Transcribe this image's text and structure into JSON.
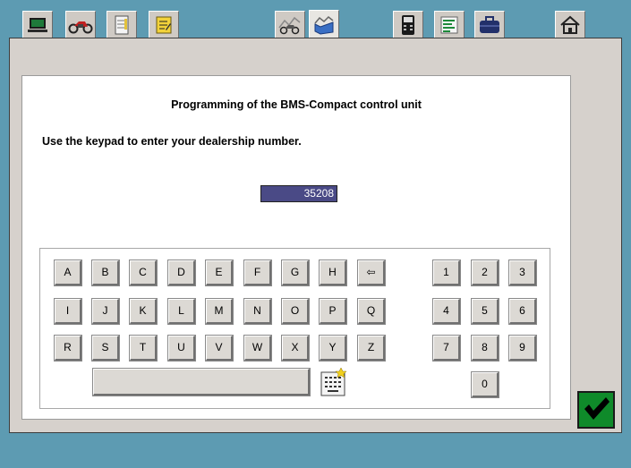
{
  "toolbar": {
    "tabs": [
      {
        "icon": "laptop-icon"
      },
      {
        "icon": "motorcycle-icon"
      },
      {
        "icon": "notepad-icon"
      },
      {
        "icon": "notes-edit-icon"
      },
      {
        "icon": "motorcycle-chart-icon"
      },
      {
        "icon": "chart-box-icon"
      },
      {
        "icon": "control-unit-icon"
      },
      {
        "icon": "list-icon"
      },
      {
        "icon": "toolcase-icon"
      },
      {
        "icon": "house-icon"
      }
    ]
  },
  "dialog": {
    "title": "Programming of the BMS-Compact control unit",
    "instruction": "Use the keypad to enter your dealership number.",
    "entry_value": "35208"
  },
  "keypad": {
    "letter_rows": [
      [
        "A",
        "B",
        "C",
        "D",
        "E",
        "F",
        "G",
        "H",
        "⇦"
      ],
      [
        "I",
        "J",
        "K",
        "L",
        "M",
        "N",
        "O",
        "P",
        "Q"
      ],
      [
        "R",
        "S",
        "T",
        "U",
        "V",
        "W",
        "X",
        "Y",
        "Z"
      ]
    ],
    "digit_rows": [
      [
        "1",
        "2",
        "3"
      ],
      [
        "4",
        "5",
        "6"
      ],
      [
        "7",
        "8",
        "9"
      ],
      [
        "0"
      ]
    ]
  },
  "colors": {
    "background": "#5d9bb2",
    "frame": "#d6d1cc",
    "entry_field": "#4a4a86",
    "ok_button": "#0f8a2a"
  }
}
